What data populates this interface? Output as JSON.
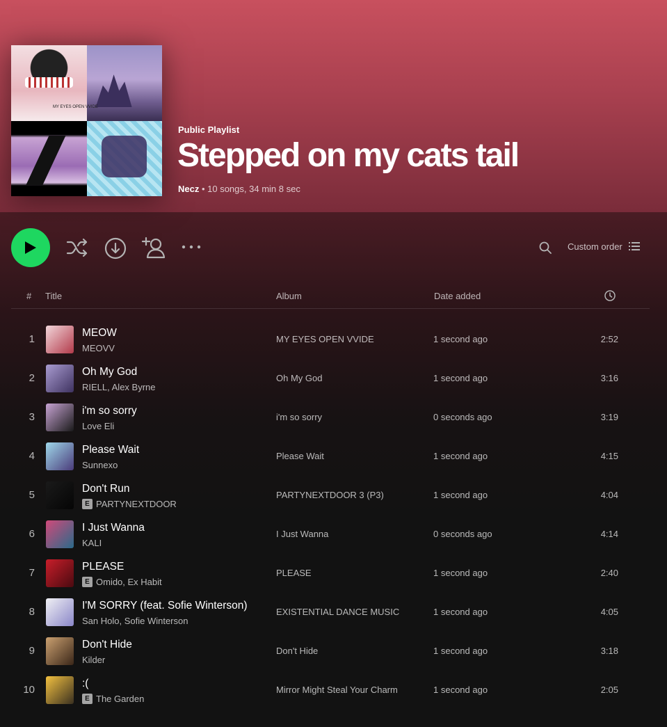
{
  "playlist": {
    "type_label": "Public Playlist",
    "title": "Stepped on my cats tail",
    "owner": "Necz",
    "summary": " • 10 songs, 34 min 8 sec",
    "cover_caption": "MY EYES OPEN VVIDE"
  },
  "actions": {
    "play": "play-icon",
    "shuffle": "shuffle-icon",
    "download": "download-icon",
    "add_user": "add-user-icon",
    "more": "more-icon",
    "search": "search-icon",
    "sort_label": "Custom order",
    "sort_icon": "list-icon"
  },
  "table": {
    "headers": {
      "num": "#",
      "title": "Title",
      "album": "Album",
      "date": "Date added",
      "duration": "clock-icon"
    },
    "rows": [
      {
        "num": "1",
        "title": "MEOW",
        "artist": "MEOVV",
        "explicit": false,
        "album": "MY EYES OPEN VVIDE",
        "date": "1 second ago",
        "duration": "2:52",
        "thumb": [
          "#f2d6da",
          "#b23a4a"
        ]
      },
      {
        "num": "2",
        "title": "Oh My God",
        "artist": "RIELL, Alex Byrne",
        "explicit": false,
        "album": "Oh My God",
        "date": "1 second ago",
        "duration": "3:16",
        "thumb": [
          "#a99bd0",
          "#3e3260"
        ]
      },
      {
        "num": "3",
        "title": "i'm so sorry",
        "artist": "Love Eli",
        "explicit": false,
        "album": "i'm so sorry",
        "date": "0 seconds ago",
        "duration": "3:19",
        "thumb": [
          "#c7a3d3",
          "#1a1a1a"
        ]
      },
      {
        "num": "4",
        "title": "Please Wait",
        "artist": "Sunnexo",
        "explicit": false,
        "album": "Please Wait",
        "date": "1 second ago",
        "duration": "4:15",
        "thumb": [
          "#9fd8ea",
          "#4a3b7a"
        ]
      },
      {
        "num": "5",
        "title": "Don't Run",
        "artist": "PARTYNEXTDOOR",
        "explicit": true,
        "album": "PARTYNEXTDOOR 3 (P3)",
        "date": "1 second ago",
        "duration": "4:04",
        "thumb": [
          "#1a1a1a",
          "#050505"
        ]
      },
      {
        "num": "6",
        "title": "I Just Wanna",
        "artist": "KALI",
        "explicit": false,
        "album": "I Just Wanna",
        "date": "0 seconds ago",
        "duration": "4:14",
        "thumb": [
          "#d04a7a",
          "#2a6a8a"
        ]
      },
      {
        "num": "7",
        "title": "PLEASE",
        "artist": "Omido, Ex Habit",
        "explicit": true,
        "album": "PLEASE",
        "date": "1 second ago",
        "duration": "2:40",
        "thumb": [
          "#c81e2a",
          "#4a0a10"
        ]
      },
      {
        "num": "8",
        "title": "I'M SORRY (feat. Sofie Winterson)",
        "artist": "San Holo, Sofie Winterson",
        "explicit": false,
        "album": "EXISTENTIAL DANCE MUSIC",
        "date": "1 second ago",
        "duration": "4:05",
        "thumb": [
          "#f0f0f4",
          "#8a86c8"
        ]
      },
      {
        "num": "9",
        "title": "Don't Hide",
        "artist": "Kilder",
        "explicit": false,
        "album": "Don't Hide",
        "date": "1 second ago",
        "duration": "3:18",
        "thumb": [
          "#caa070",
          "#3a2618"
        ]
      },
      {
        "num": "10",
        "title": ":(",
        "artist": "The Garden",
        "explicit": true,
        "album": "Mirror Might Steal Your Charm",
        "date": "1 second ago",
        "duration": "2:05",
        "thumb": [
          "#f2c040",
          "#3a3020"
        ]
      }
    ]
  },
  "colors": {
    "accent": "#1ed760",
    "hero": "#c8505e",
    "background": "#121212"
  }
}
